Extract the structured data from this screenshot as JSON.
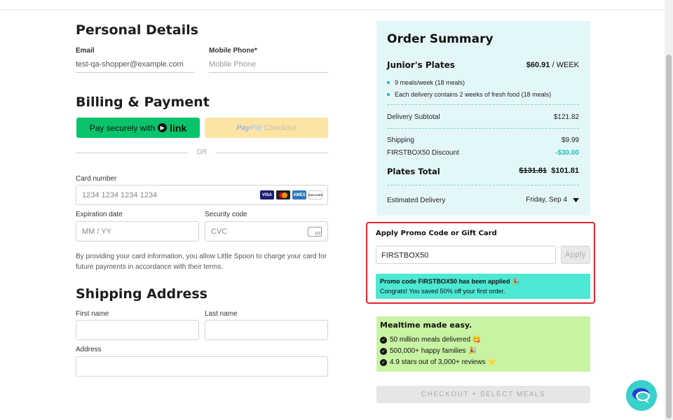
{
  "personal": {
    "title": "Personal Details",
    "email_label": "Email",
    "email_value": "test-qa-shopper@example.com",
    "phone_label": "Mobile Phone*",
    "phone_placeholder": "Mobile Phone"
  },
  "billing": {
    "title": "Billing & Payment",
    "link_button_prefix": "Pay securely with",
    "link_button_brand": "link",
    "paypal_logo_pay": "Pay",
    "paypal_logo_pal": "Pal",
    "paypal_text": "Checkout",
    "or_text": "OR",
    "card_number_label": "Card number",
    "card_number_placeholder": "1234 1234 1234 1234",
    "card_brands": [
      "VISA",
      "MC",
      "AMEX",
      "DISCOVER"
    ],
    "expiry_label": "Expiration date",
    "expiry_placeholder": "MM / YY",
    "cvc_label": "Security code",
    "cvc_placeholder": "CVC",
    "cvc_icon_text": "123",
    "disclaimer": "By providing your card information, you allow Little Spoon to charge your card for future payments in accordance with their terms."
  },
  "shipping": {
    "title": "Shipping Address",
    "first_name_label": "First name",
    "last_name_label": "Last name",
    "address_label": "Address"
  },
  "summary": {
    "title": "Order Summary",
    "plan_name": "Junior's Plates",
    "plan_price": "$60.91",
    "plan_period": "/ WEEK",
    "bullets": [
      "9 meals/week (18 meals)",
      "Each delivery contains 2 weeks of fresh food (18 meals)"
    ],
    "delivery_subtotal_label": "Delivery Subtotal",
    "delivery_subtotal_value": "$121.82",
    "shipping_label": "Shipping",
    "shipping_value": "$9.99",
    "discount_label": "FIRSTBOX50 Discount",
    "discount_value": "-$30.00",
    "total_label": "Plates Total",
    "total_old": "$131.81",
    "total_new": "$101.81",
    "estimated_label": "Estimated Delivery",
    "estimated_value": "Friday, Sep 4",
    "colors": {
      "bg": "#e4f7f8",
      "discount": "#2bbbb5"
    }
  },
  "promo": {
    "title": "Apply Promo Code or Gift Card",
    "input_value": "FIRSTBOX50",
    "apply_label": "Apply",
    "msg_line1": "Promo code FIRSTBOX50 has been applied 🎉",
    "msg_line2": "Congrats! You saved 50% off your first order.",
    "highlight_color": "#e0262d"
  },
  "mealtime": {
    "title": "Mealtime made easy.",
    "items": [
      "50 million meals delivered 😋",
      "500,000+ happy families 🎉",
      "4.9 stars out of 3,000+ reviews ⭐"
    ]
  },
  "checkout": {
    "label": "CHECKOUT + SELECT MEALS"
  },
  "icons": {
    "chat": "chat-bubble-icon",
    "dropdown": "caret-down-icon",
    "check": "check-circle-icon"
  }
}
